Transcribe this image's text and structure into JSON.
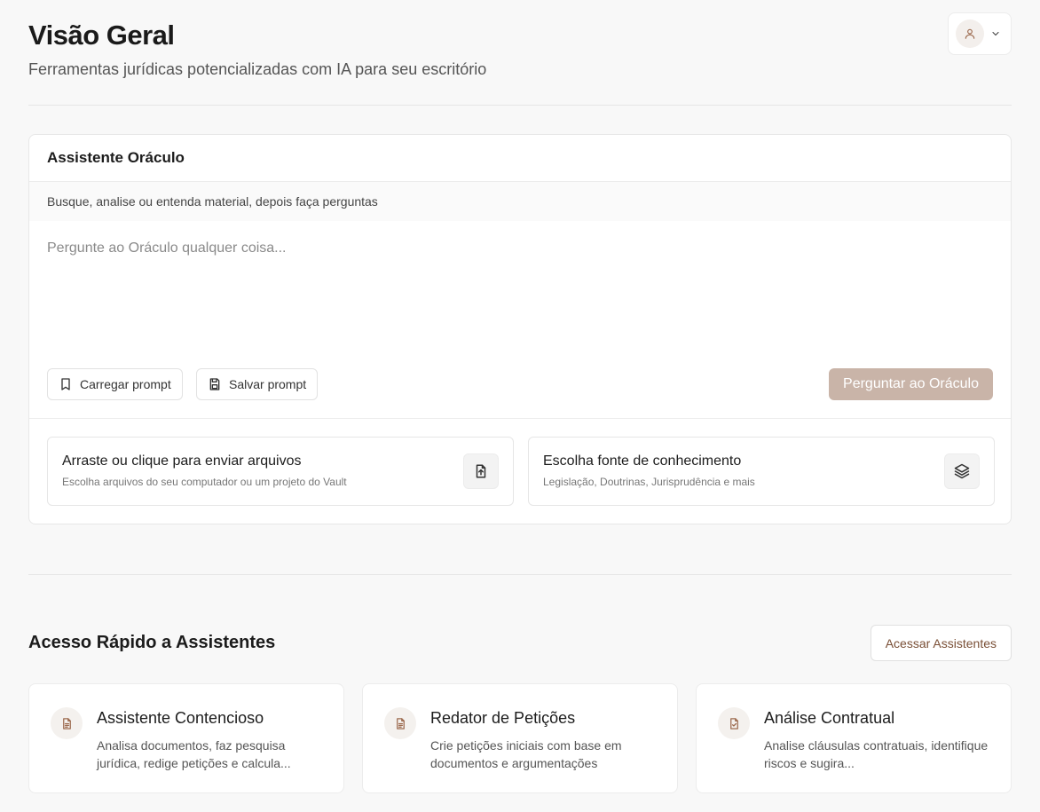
{
  "header": {
    "title": "Visão Geral",
    "subtitle": "Ferramentas jurídicas potencializadas com IA para seu escritório"
  },
  "oracle": {
    "title": "Assistente Oráculo",
    "description": "Busque, analise ou entenda material, depois faça perguntas",
    "input_placeholder": "Pergunte ao Oráculo qualquer coisa...",
    "input_value": "",
    "load_prompt_label": "Carregar prompt",
    "save_prompt_label": "Salvar prompt",
    "ask_label": "Perguntar ao Oráculo",
    "upload": {
      "title": "Arraste ou clique para enviar arquivos",
      "subtitle": "Escolha arquivos do seu computador ou um projeto do Vault"
    },
    "knowledge": {
      "title": "Escolha fonte de conhecimento",
      "subtitle": "Legislação, Doutrinas, Jurisprudência e mais"
    }
  },
  "quick_access": {
    "title": "Acesso Rápido a Assistentes",
    "button_label": "Acessar Assistentes",
    "cards": [
      {
        "title": "Assistente Contencioso",
        "description": "Analisa documentos, faz pesquisa jurídica, redige petições e calcula...",
        "icon": "document-icon"
      },
      {
        "title": "Redator de Petições",
        "description": "Crie petições iniciais com base em documentos e argumentações",
        "icon": "document-icon"
      },
      {
        "title": "Análise Contratual",
        "description": "Analise cláusulas contratuais, identifique riscos e sugira...",
        "icon": "document-check-icon"
      }
    ]
  },
  "colors": {
    "accent": "#7a4f36",
    "primary_button_disabled": "#c9b4a8",
    "icon": "#9c6a4e"
  }
}
